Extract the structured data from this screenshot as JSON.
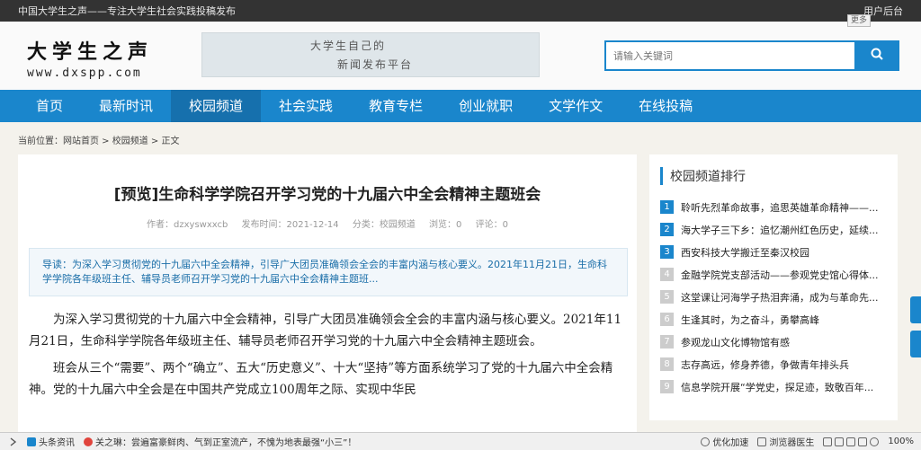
{
  "topbar": {
    "site_slogan": "中国大学生之声——专注大学生社会实践投稿发布",
    "user_center": "用户后台"
  },
  "header": {
    "logo_cn": "大学生之声",
    "logo_en": "www.dxspp.com",
    "banner_line1": "大学生自己的",
    "banner_line2": "新闻发布平台",
    "more_tag": "更多",
    "search_placeholder": "请输入关键词",
    "search_icon": "search-icon"
  },
  "nav": [
    "首页",
    "最新时讯",
    "校园频道",
    "社会实践",
    "教育专栏",
    "创业就职",
    "文学作文",
    "在线投稿"
  ],
  "breadcrumb": "当前位置：网站首页 > 校园频道 > 正文",
  "article": {
    "title": "[预览]生命科学学院召开学习党的十九届六中全会精神主题班会",
    "author": "作者：dzxyswxxcb",
    "date": "发布时间：2021-12-14",
    "category": "分类：校园频道",
    "views": "浏览：0",
    "comments": "评论：0",
    "lead": "导读：为深入学习贯彻党的十九届六中全会精神，引导广大团员准确领会全会的丰富内涵与核心要义。2021年11月21日，生命科学学院各年级班主任、辅导员老师召开学习党的十九届六中全会精神主题班...",
    "p1": "为深入学习贯彻党的十九届六中全会精神，引导广大团员准确领会全会的丰富内涵与核心要义。2021年11月21日，生命科学学院各年级班主任、辅导员老师召开学习党的十九届六中全会精神主题班会。",
    "p2": "班会从三个“需要”、两个“确立”、五大“历史意义”、十大“坚持”等方面系统学习了党的十九届六中全会精神。党的十九届六中全会是在中国共产党成立100周年之际、实现中华民"
  },
  "sidebar": {
    "title": "校园频道排行",
    "items": [
      {
        "n": "1",
        "t": "聆听先烈革命故事，追思英雄革命精神——..."
      },
      {
        "n": "2",
        "t": "海大学子三下乡：追忆潮州红色历史，延续..."
      },
      {
        "n": "3",
        "t": "西安科技大学搬迁至秦汉校园"
      },
      {
        "n": "4",
        "t": "金融学院党支部活动——参观党史馆心得体..."
      },
      {
        "n": "5",
        "t": "这堂课让河海学子热泪奔涌，成为与革命先..."
      },
      {
        "n": "6",
        "t": "生逢其时，为之奋斗，勇攀高峰"
      },
      {
        "n": "7",
        "t": "参观龙山文化博物馆有感"
      },
      {
        "n": "8",
        "t": "志存高远，修身养德，争做青年排头兵"
      },
      {
        "n": "9",
        "t": "信息学院开展“学党史，探足迹，致敬百年..."
      }
    ]
  },
  "statusbar": {
    "news": "头条资讯",
    "headline": "关之琳：尝遍富豪鲜肉、气到正室流产，不愧为地表最强“小三”！",
    "accelerate": "优化加速",
    "doctor": "浏览器医生",
    "zoom": "100%"
  },
  "colors": {
    "brand": "#1a86cc",
    "nav_active": "#1670ad"
  }
}
